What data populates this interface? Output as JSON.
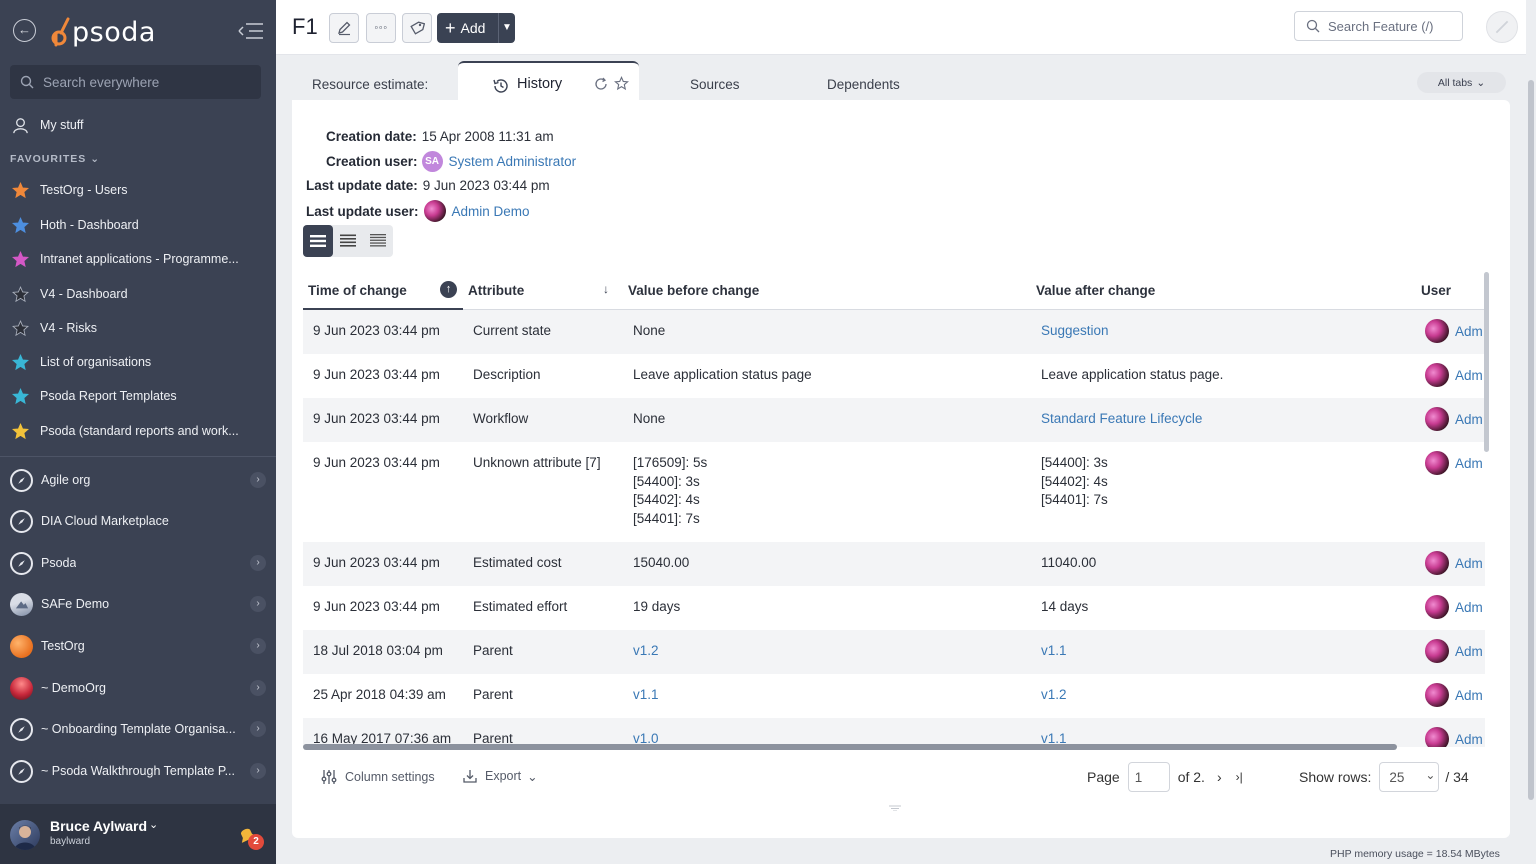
{
  "sidebar": {
    "logo_text": "psoda",
    "search_placeholder": "Search everywhere",
    "my_stuff": "My stuff",
    "favourites_header": "FAVOURITES",
    "favourites": [
      {
        "label": "TestOrg - Users",
        "color": "#f0883a"
      },
      {
        "label": "Hoth - Dashboard",
        "color": "#4d8fe0"
      },
      {
        "label": "Intranet applications - Programme...",
        "color": "#d458c6"
      },
      {
        "label": "V4 - Dashboard",
        "color": "#2c2f38"
      },
      {
        "label": "V4 - Risks",
        "color": "#2c2f38"
      },
      {
        "label": "List of organisations",
        "color": "#39b7d6"
      },
      {
        "label": "Psoda Report Templates",
        "color": "#39b7d6"
      },
      {
        "label": "Psoda (standard reports and work...",
        "color": "#f2c23a"
      }
    ],
    "orgs": [
      {
        "label": "Agile org",
        "icon": "compass-icon",
        "chevron": true
      },
      {
        "label": "DIA Cloud Marketplace",
        "icon": "compass-icon",
        "chevron": false
      },
      {
        "label": "Psoda",
        "icon": "compass-icon",
        "chevron": true
      },
      {
        "label": "SAFe Demo",
        "icon": "mountain-icon",
        "chevron": true
      },
      {
        "label": "TestOrg",
        "icon": "orange-orb-icon",
        "chevron": true
      },
      {
        "label": "~ DemoOrg",
        "icon": "red-orb-icon",
        "chevron": true
      },
      {
        "label": "~ Onboarding Template Organisa...",
        "icon": "compass-icon",
        "chevron": true
      },
      {
        "label": "~ Psoda Walkthrough Template P...",
        "icon": "compass-icon",
        "chevron": true
      }
    ],
    "user": {
      "name": "Bruce Aylward",
      "login": "baylward",
      "notifications": "2"
    }
  },
  "topbar": {
    "title": "F1",
    "add_label": "Add",
    "search_placeholder": "Search Feature (/)"
  },
  "tabs": {
    "items": [
      "Resource estimate:",
      "History",
      "Sources",
      "Dependents"
    ],
    "active": "History",
    "all_tabs": "All tabs"
  },
  "meta": {
    "creation_date_label": "Creation date:",
    "creation_date": "15 Apr 2008 11:31 am",
    "creation_user_label": "Creation user:",
    "creation_user_initials": "SA",
    "creation_user": "System Administrator",
    "update_date_label": "Last update date:",
    "update_date": "9 Jun 2023 03:44 pm",
    "update_user_label": "Last update user:",
    "update_user": "Admin Demo"
  },
  "table": {
    "headers": [
      "Time of change",
      "Attribute",
      "Value before change",
      "Value after change",
      "User"
    ],
    "rows": [
      {
        "time": "9 Jun 2023 03:44 pm",
        "attr": "Current state",
        "before": [
          "None"
        ],
        "before_link": false,
        "after": [
          "Suggestion"
        ],
        "after_link": true,
        "user": "Adm"
      },
      {
        "time": "9 Jun 2023 03:44 pm",
        "attr": "Description",
        "before": [
          "Leave application status page"
        ],
        "before_link": false,
        "after": [
          "Leave application status page."
        ],
        "after_link": false,
        "user": "Adm"
      },
      {
        "time": "9 Jun 2023 03:44 pm",
        "attr": "Workflow",
        "before": [
          "None"
        ],
        "before_link": false,
        "after": [
          "Standard Feature Lifecycle"
        ],
        "after_link": true,
        "user": "Adm"
      },
      {
        "time": "9 Jun 2023 03:44 pm",
        "attr": "Unknown attribute [7]",
        "before": [
          "[176509]: 5s",
          "[54400]: 3s",
          "[54402]: 4s",
          "[54401]: 7s"
        ],
        "before_link": false,
        "after": [
          "[54400]: 3s",
          "[54402]: 4s",
          "[54401]: 7s"
        ],
        "after_link": false,
        "user": "Adm"
      },
      {
        "time": "9 Jun 2023 03:44 pm",
        "attr": "Estimated cost",
        "before": [
          "15040.00"
        ],
        "before_link": false,
        "after": [
          "11040.00"
        ],
        "after_link": false,
        "user": "Adm"
      },
      {
        "time": "9 Jun 2023 03:44 pm",
        "attr": "Estimated effort",
        "before": [
          "19 days"
        ],
        "before_link": false,
        "after": [
          "14 days"
        ],
        "after_link": false,
        "user": "Adm"
      },
      {
        "time": "18 Jul 2018 03:04 pm",
        "attr": "Parent",
        "before": [
          "v1.2"
        ],
        "before_link": true,
        "after": [
          "v1.1"
        ],
        "after_link": true,
        "user": "Adm"
      },
      {
        "time": "25 Apr 2018 04:39 am",
        "attr": "Parent",
        "before": [
          "v1.1"
        ],
        "before_link": true,
        "after": [
          "v1.2"
        ],
        "after_link": true,
        "user": "Adm"
      },
      {
        "time": "16 May 2017 07:36 am",
        "attr": "Parent",
        "before": [
          "v1.0"
        ],
        "before_link": true,
        "after": [
          "v1.1"
        ],
        "after_link": true,
        "user": "Adm"
      }
    ]
  },
  "footer": {
    "column_settings": "Column settings",
    "export": "Export",
    "page_label": "Page",
    "page_value": "1",
    "of_pages": "of 2.",
    "show_rows_label": "Show rows:",
    "rows_value": "25",
    "total": "/ 34"
  },
  "memory": "PHP memory usage = 18.54 MBytes"
}
